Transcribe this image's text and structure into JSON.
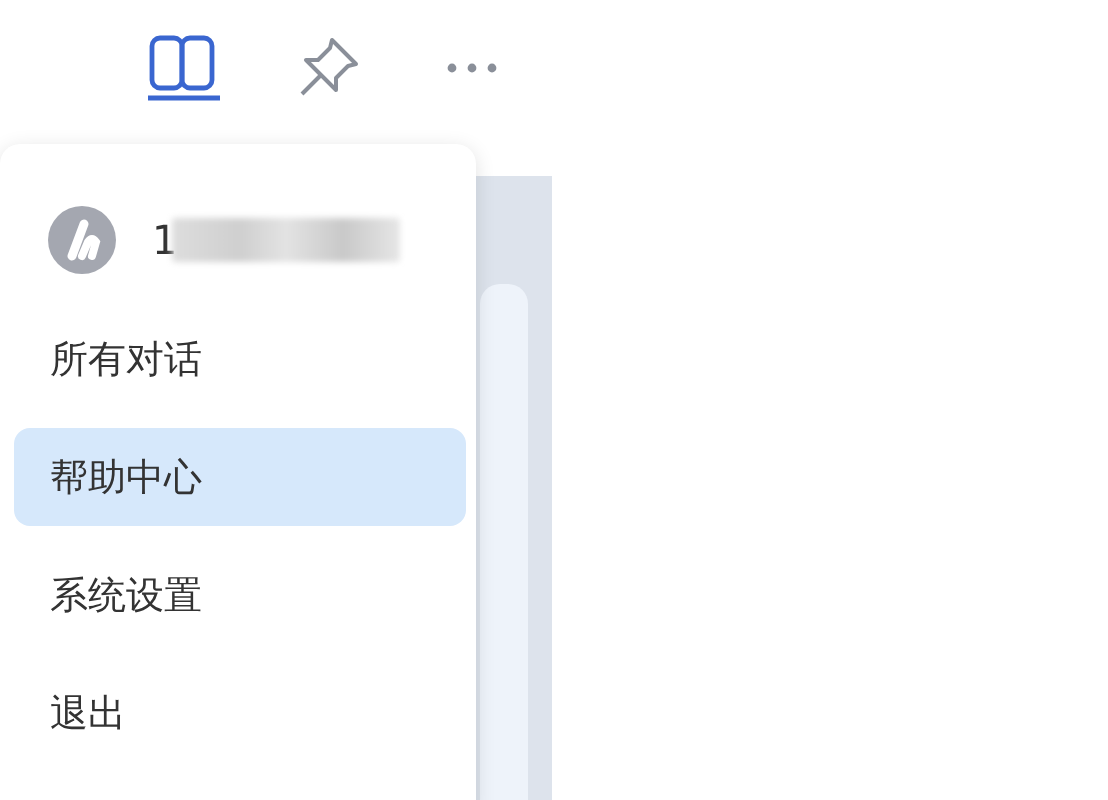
{
  "toolbar": [
    {
      "kind": "book",
      "selected": true
    },
    {
      "kind": "pin",
      "selected": false
    },
    {
      "kind": "more",
      "selected": false
    }
  ],
  "menu": {
    "user": {
      "name": "1"
    },
    "items": [
      {
        "label": "所有对话",
        "selected": false
      },
      {
        "label": "帮助中心",
        "selected": true
      },
      {
        "label": "系统设置",
        "selected": false
      },
      {
        "label": "退出",
        "selected": false
      }
    ]
  }
}
